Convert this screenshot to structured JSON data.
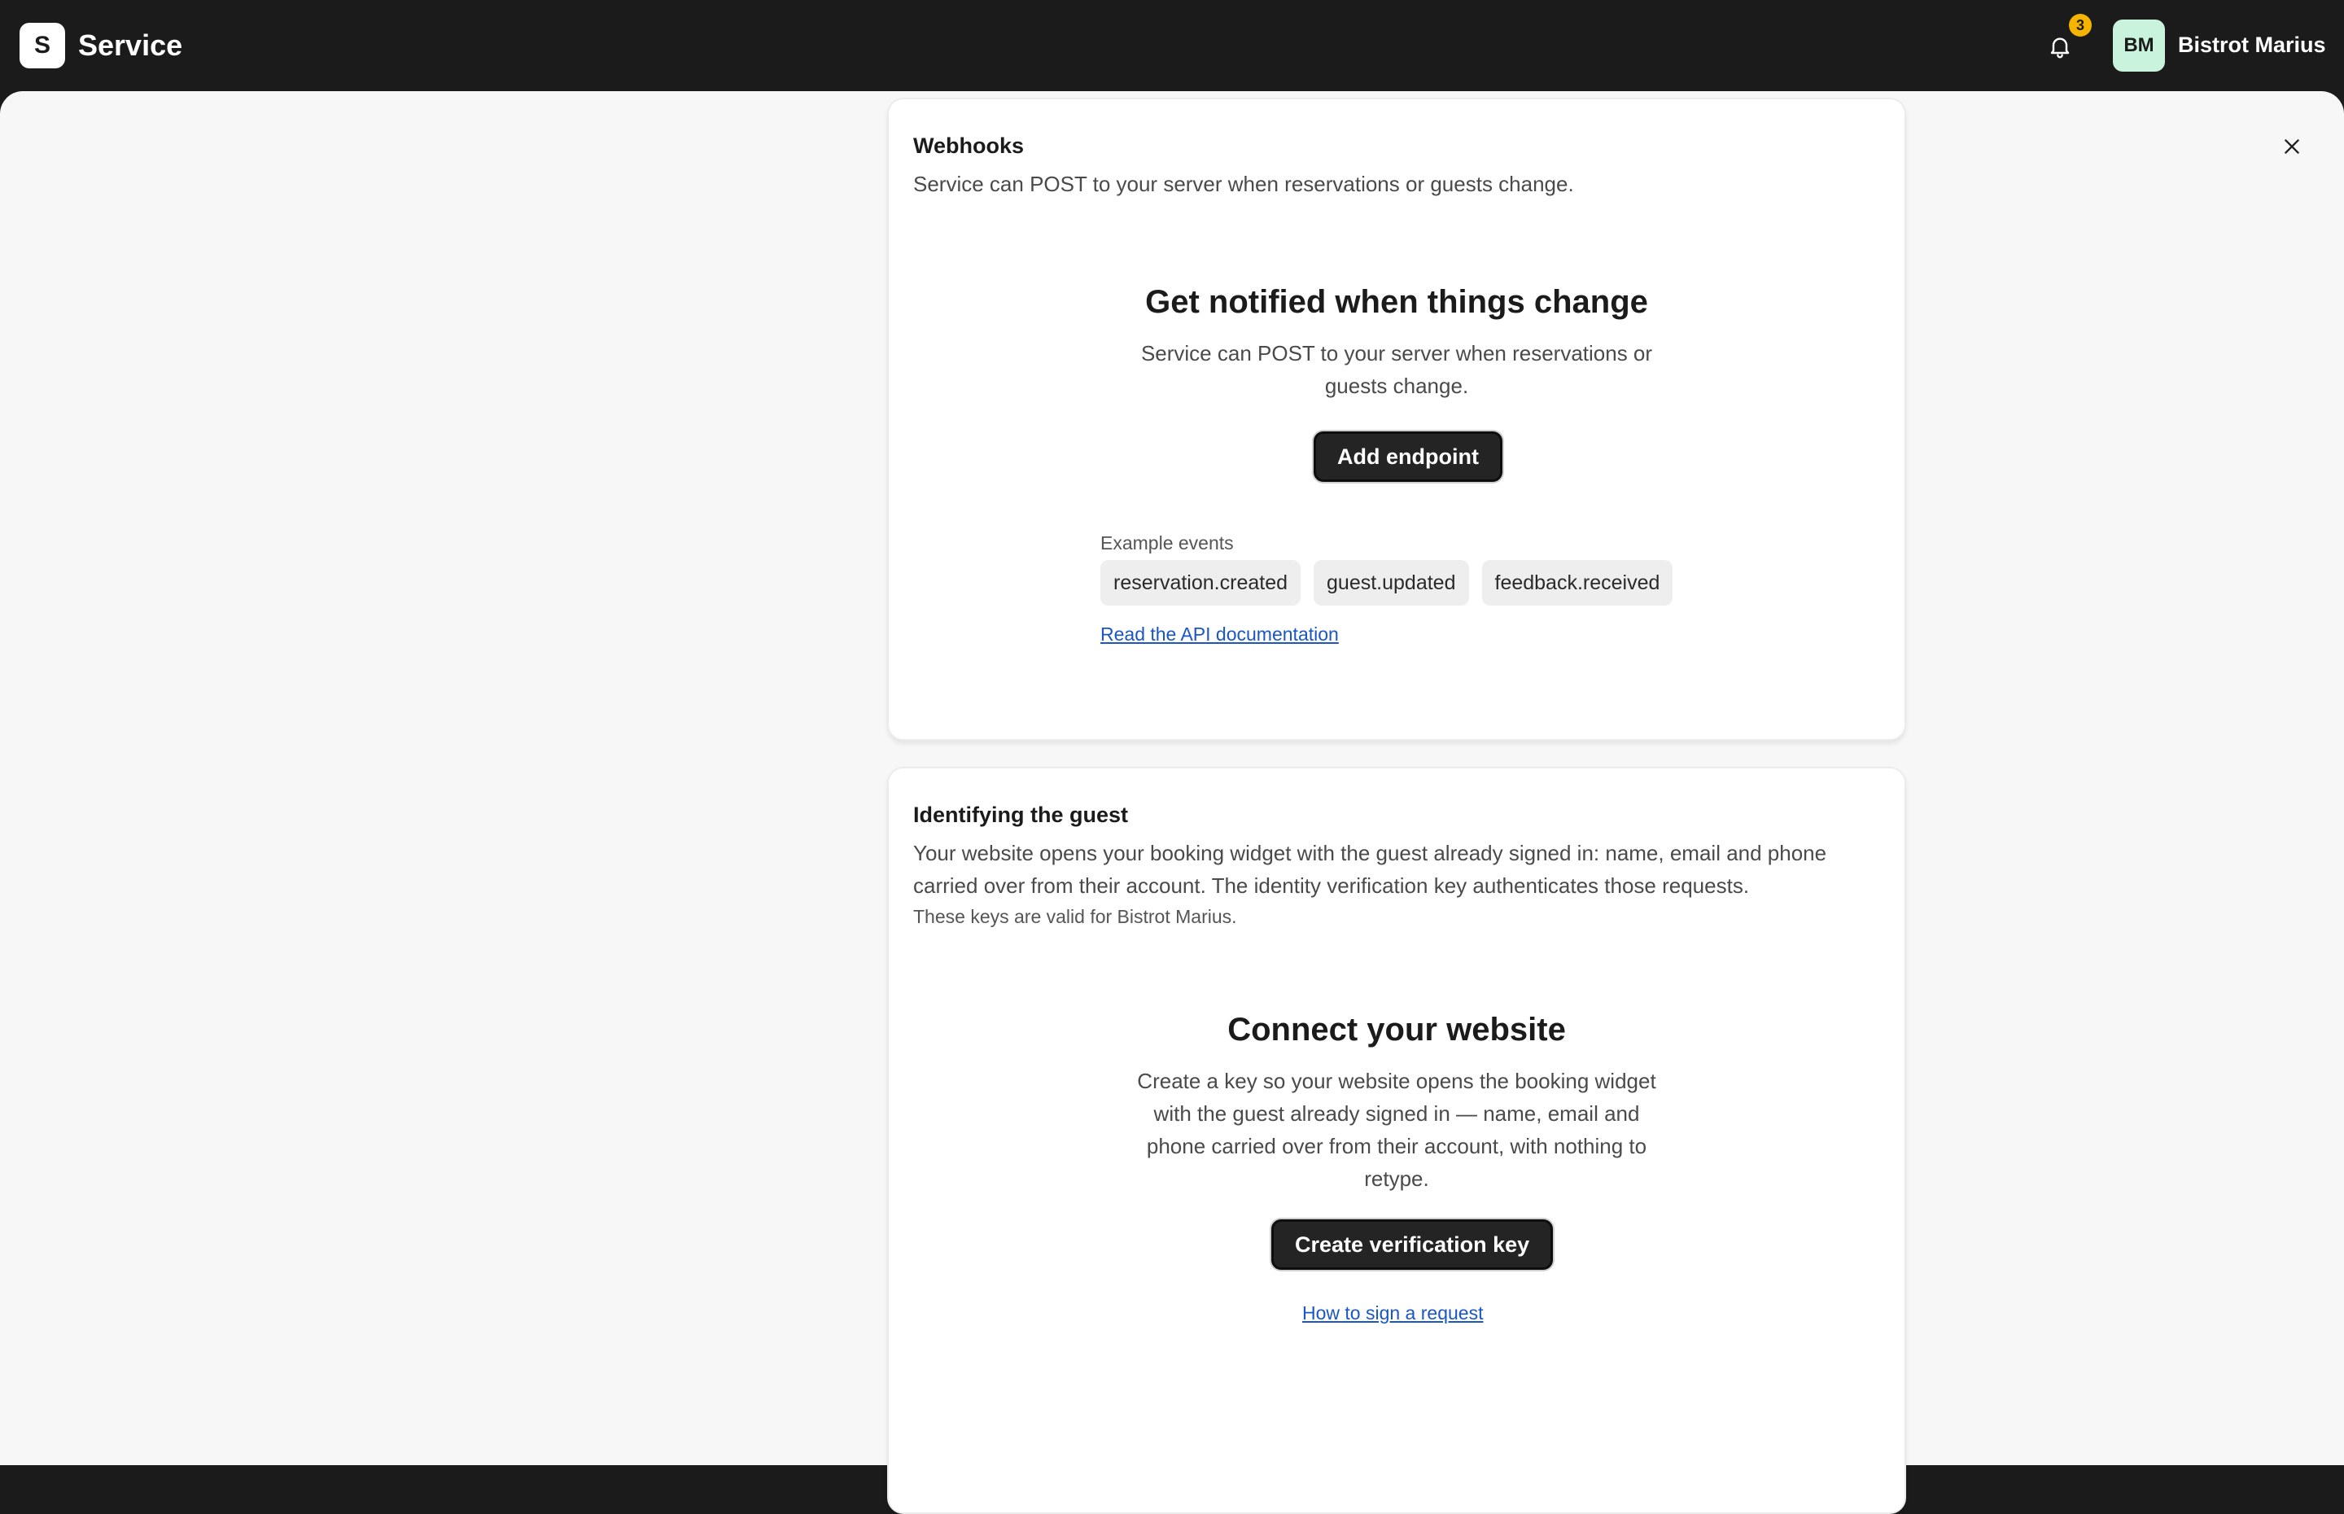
{
  "header": {
    "logo_letter": "S",
    "app_name": "Service",
    "notification_count": "3",
    "avatar_initials": "BM",
    "restaurant_name": "Bistrot Marius"
  },
  "colors": {
    "topbar": "#1b1b1b",
    "badge": "#f5b400",
    "avatar_bg": "#c9f3dd",
    "link": "#1a56c4",
    "primary_button": "#242424"
  },
  "webhooks": {
    "title": "Webhooks",
    "description": "Service can POST to your server when reservations or guests change.",
    "empty_title": "Get notified when things change",
    "empty_description": "Service can POST to your server when reservations or guests change.",
    "add_button": "Add endpoint",
    "events_label": "Example events",
    "events": [
      "reservation.created",
      "guest.updated",
      "feedback.received"
    ],
    "docs_link": "Read the API documentation"
  },
  "identity": {
    "title": "Identifying the guest",
    "description": "Your website opens your booking widget with the guest already signed in: name, email and phone carried over from their account. The identity verification key authenticates those requests.",
    "note": "These keys are valid for Bistrot Marius.",
    "empty_title": "Connect your website",
    "empty_description": "Create a key so your website opens the booking widget with the guest already signed in — name, email and phone carried over from their account, with nothing to retype.",
    "create_button": "Create verification key",
    "sign_link": "How to sign a request"
  }
}
